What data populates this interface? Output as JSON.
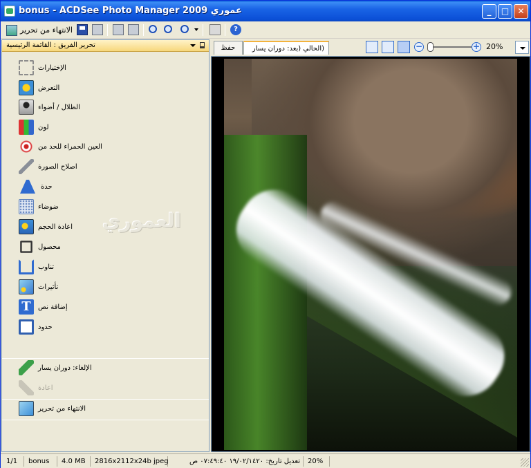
{
  "window": {
    "title": "bonus - ACDSee Photo Manager 2009 عموري",
    "minimize_label": "_",
    "maximize_label": "□",
    "close_label": "✕"
  },
  "toolbar": {
    "finish_label": "الانتهاء من تحرير"
  },
  "panel": {
    "title": "تحرير الفريق : القائمة الرئيسية",
    "watermark": "العموري",
    "items": [
      {
        "label": "الإختيارات",
        "icon": "selection-icon"
      },
      {
        "label": "التعرض",
        "icon": "exposure-icon"
      },
      {
        "label": "الظلال / أضواء",
        "icon": "shadows-highlights-icon"
      },
      {
        "label": "لون",
        "icon": "color-icon"
      },
      {
        "label": "العين الحمراء للحد من",
        "icon": "red-eye-icon"
      },
      {
        "label": "اصلاح الصورة",
        "icon": "repair-wrench-icon"
      },
      {
        "label": "حدة",
        "icon": "sharpen-icon"
      },
      {
        "label": "ضوضاء",
        "icon": "noise-icon"
      },
      {
        "label": "اعادة الحجم",
        "icon": "resize-icon"
      },
      {
        "label": "محصول",
        "icon": "crop-icon"
      },
      {
        "label": "تناوب",
        "icon": "rotate-icon"
      },
      {
        "label": "تأثيرات",
        "icon": "effects-icon"
      },
      {
        "label": "إضافة نص",
        "icon": "text-icon"
      },
      {
        "label": "حدود",
        "icon": "borders-icon"
      }
    ],
    "undo_label": "الإلغاء: دوران يسار",
    "redo_label": "اعادة",
    "done_label": "الانتهاء من تحرير",
    "text_icon_glyph": "T"
  },
  "tabs": {
    "save_label": "حفظ",
    "current_label": "(الحالي (بعد: دوران يسار"
  },
  "zoom": {
    "minus_glyph": "−",
    "plus_glyph": "+",
    "value": "20%"
  },
  "status": {
    "page": "1/1",
    "filename": "bonus",
    "filesize": "4.0 MB",
    "dimensions": "2816x2112x24b jpeg",
    "modified": "تعديل تاريخ: ١٩/٠٢/١٤٢٠ ٠٧:٤٩:٤٠ ص",
    "zoom": "20%"
  },
  "colors": {
    "title_bar": "#0b4fd6",
    "panel_header": "#f7d77c",
    "accent_blue": "#2f6bd0"
  }
}
